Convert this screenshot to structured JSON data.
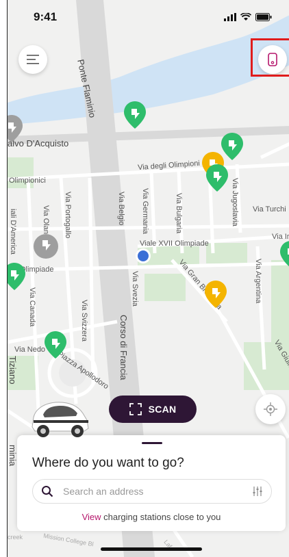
{
  "status_bar": {
    "time": "9:41"
  },
  "map": {
    "streets": {
      "ponte_flaminio": "Ponte Flaminio",
      "salvo_dacquisto": "alvo D'Acquisto",
      "via_degli_olimpionici": "Via degli Olimpioni",
      "olimpionici": "Olimpionici",
      "via_portogallo": "Via Portogallo",
      "via_olanda": "Via Oland",
      "viali_damerica": "iali D'America",
      "olimpiade": "Olimpiade",
      "via_belgio": "Via Belgio",
      "via_germania": "Via Germania",
      "via_bulgaria": "Via Bulgaria",
      "via_jugoslavia": "Via Jugoslavia",
      "via_turchia": "Via Turchi",
      "via_ir": "Via Ir",
      "viale_xvii_olimpiade": "Viale XVII Olimpiade",
      "via_argentina": "Via Argentina",
      "via_gran_bretagna": "Via Gran Bretagna",
      "via_svezia": "Via Svezia",
      "via_canada": "Via Canada",
      "via_svizzera": "Via Svizzera",
      "corso_di_francia": "Corso di Francia",
      "via_nedo": "Via Nedo",
      "piazza_apollodoro": "Piazza Apollodoro",
      "tiziano": "Tiziano",
      "via_giulio_gaudini": "Via Giulio Gaudini",
      "flaminia": "minia",
      "mission_college": "Mission College Bl",
      "creek": "creek",
      "laf": "Laf"
    },
    "colors": {
      "water": "#cfe3f5",
      "park": "#d7ead2",
      "road": "#ffffff",
      "major_road": "#d9d9d9",
      "pin_green": "#2ebd6b",
      "pin_yellow": "#f4b400",
      "pin_grey": "#9e9e9e",
      "user_location": "#3b6fd6"
    }
  },
  "scan_button": {
    "label": "SCAN",
    "icon": "scan-frame-icon"
  },
  "bottom_sheet": {
    "title": "Where do you want to go?",
    "search_placeholder": "Search an address",
    "view_link": "View",
    "view_rest": " charging stations close to you"
  },
  "icons": {
    "menu": "menu-icon",
    "phone": "phone-icon",
    "locate": "locate-icon",
    "search": "search-icon",
    "filter": "filter-sliders-icon"
  }
}
